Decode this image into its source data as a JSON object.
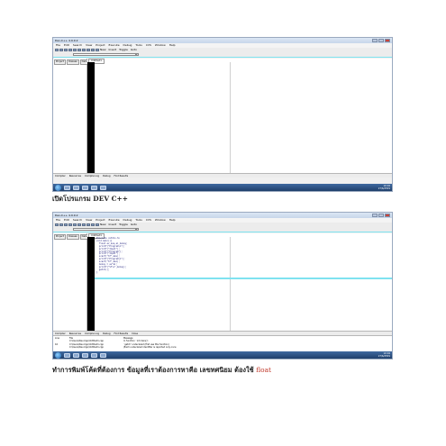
{
  "window": {
    "title": "Dev-C++ 4.9.9.2"
  },
  "menu": [
    "File",
    "Edit",
    "Search",
    "View",
    "Project",
    "Execute",
    "Debug",
    "Tools",
    "CVS",
    "Window",
    "Help"
  ],
  "toolbar_labels": [
    "New",
    "Insert",
    "Toggle",
    "Goto"
  ],
  "side_tabs": [
    "Project",
    "Classes",
    "Debug"
  ],
  "editor_tab": "Untitled1",
  "bottom_tabs": [
    "Compiler",
    "Resources",
    "Compile Log",
    "Debug",
    "Find Results"
  ],
  "bottom_tabs_2": [
    "Compiler",
    "Resources",
    "Compile Log",
    "Debug",
    "Find Results",
    "Close"
  ],
  "clock": {
    "time": "10:04",
    "date": "27/6/2559"
  },
  "code_lines": [
    "#include <stdio.h>",
    "void main(){",
    "",
    "  float av_ave,ai_money;",
    "  printf(\"Program\\n\");",
    "  printf(\"Input\");",
    "  printf(\"Program\");",
    "  printf(\"Input\");",
    "  scanf(\"%f\",&av);",
    "  printf(\"Program\\n\");",
    "  scanf(\"%f\",&ai);",
    "  money = av*ai;",
    "  printf(\"%f\\n\",money);",
    "  getch();",
    "}"
  ],
  "compile_log": {
    "headers": [
      "Line",
      "File",
      "Message"
    ],
    "rows": [
      [
        "",
        "C:\\Users\\Dev-Cpp\\Untitled1.cpp",
        "In function `int main()':"
      ],
      [
        "16",
        "C:\\Users\\Dev-Cpp\\Untitled1.cpp",
        "`getch' undeclared (first use this function)"
      ],
      [
        "",
        "C:\\Users\\Dev-Cpp\\Untitled1.cpp",
        "(Each undeclared identifier is reported only once"
      ]
    ]
  },
  "captions": {
    "first": "เปิดโปรแกรม DEV C++",
    "second": "ทำการพิมพ์โค้ดที่ต้องการ ข้อมูลที่เราต้องการหาคือ เลขทศนิยม ต้องใช้",
    "second_highlight": "float"
  },
  "colors": {
    "accent_line": "#7fe3f0",
    "highlight_word": "#c0392b",
    "taskbar": "#2a4f82"
  }
}
